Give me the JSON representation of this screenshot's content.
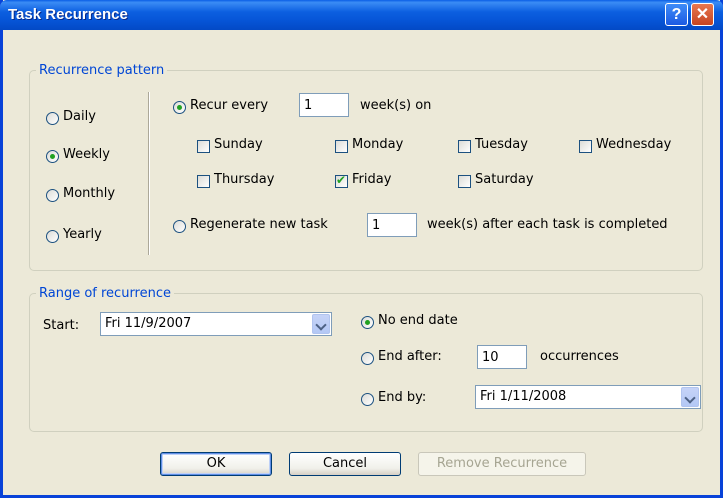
{
  "window": {
    "title": "Task Recurrence",
    "help_glyph": "?",
    "close_glyph": "✕"
  },
  "pattern": {
    "legend": "Recurrence pattern",
    "frequency_options": [
      "Daily",
      "Weekly",
      "Monthly",
      "Yearly"
    ],
    "selected_frequency": "Weekly",
    "recur_every_label": "Recur every",
    "recur_every_value": "1",
    "recur_every_suffix": "week(s) on",
    "days": [
      {
        "label": "Sunday",
        "checked": false
      },
      {
        "label": "Monday",
        "checked": false
      },
      {
        "label": "Tuesday",
        "checked": false
      },
      {
        "label": "Wednesday",
        "checked": false
      },
      {
        "label": "Thursday",
        "checked": false
      },
      {
        "label": "Friday",
        "checked": true
      },
      {
        "label": "Saturday",
        "checked": false
      }
    ],
    "regenerate_label": "Regenerate new task",
    "regenerate_value": "1",
    "regenerate_suffix": "week(s) after each task is completed"
  },
  "range": {
    "legend": "Range of recurrence",
    "start_label": "Start:",
    "start_value": "Fri 11/9/2007",
    "no_end_label": "No end date",
    "end_after_label": "End after:",
    "end_after_value": "10",
    "occurrences_label": "occurrences",
    "end_by_label": "End by:",
    "end_by_value": "Fri 1/11/2008"
  },
  "buttons": {
    "ok": "OK",
    "cancel": "Cancel",
    "remove": "Remove Recurrence"
  }
}
